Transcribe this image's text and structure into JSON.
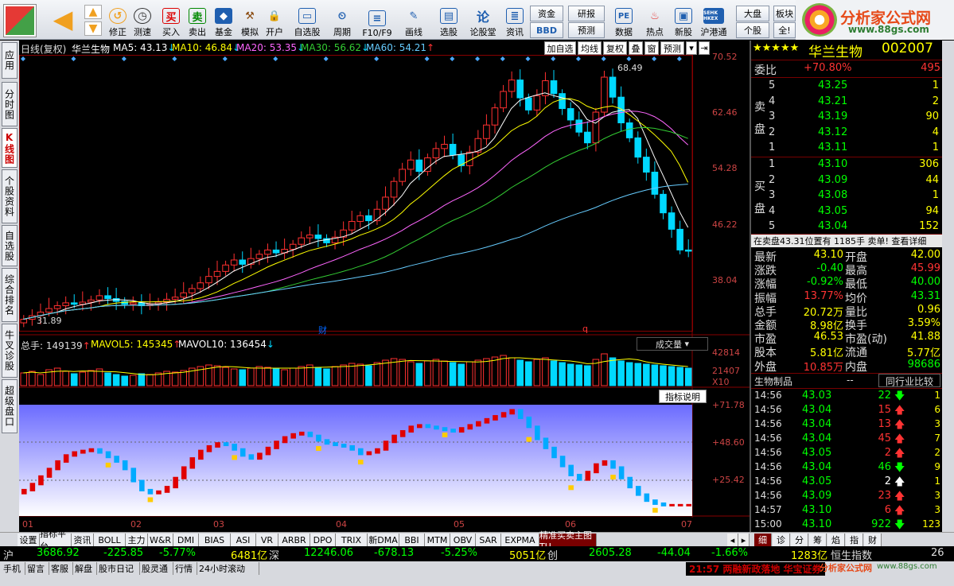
{
  "toolbar": {
    "buttons": [
      {
        "label": "买入",
        "icon": "buy-icon"
      },
      {
        "label": "卖出",
        "icon": "sell-icon"
      },
      {
        "label": "基金",
        "icon": "fund-icon"
      },
      {
        "label": "模拟",
        "icon": "hammer-icon"
      },
      {
        "label": "开户",
        "icon": "lock-icon"
      },
      {
        "label": "自选股",
        "icon": "monitor-icon"
      },
      {
        "label": "周期",
        "icon": "clock-icon"
      },
      {
        "label": "F10/F9",
        "icon": "form-icon"
      },
      {
        "label": "画线",
        "icon": "pen-icon"
      },
      {
        "label": "选股",
        "icon": "chart-icon"
      },
      {
        "label": "论股堂",
        "icon": "talk-icon"
      },
      {
        "label": "资讯",
        "icon": "info-icon"
      },
      {
        "label": "数据",
        "icon": "pe-icon"
      },
      {
        "label": "热点",
        "icon": "fire-icon"
      },
      {
        "label": "新股",
        "icon": "newstock-icon"
      },
      {
        "label": "沪港通",
        "icon": "hkex-icon"
      }
    ],
    "nav_labels": [
      "修正",
      "测速"
    ],
    "box_buttons": [
      "资金",
      "BBD",
      "研报",
      "预测",
      "大盘",
      "个股",
      "板块",
      "全!"
    ],
    "buy_char": "买",
    "sell_char": "卖",
    "glyph_lun": "论",
    "pe_text": "PE",
    "hkex_text": "SEHK HKEX"
  },
  "logo": {
    "brand": "分析家公式网",
    "url": "www.88gs.com"
  },
  "left_tabs": [
    "应用",
    "分时图",
    "K线图",
    "个股资料",
    "自选股",
    "综合排名",
    "牛叉诊股",
    "超级盘口"
  ],
  "chart_header": {
    "period": "日线(复权)",
    "stock": "华兰生物",
    "ma5": "MA5: 43.13",
    "ma10": "MA10: 46.84",
    "ma20": "MA20: 53.35",
    "ma30": "MA30: 56.62",
    "ma60": "MA60: 54.21",
    "buttons": [
      "加自选",
      "均线",
      "复权",
      "叠",
      "窗",
      "预测"
    ]
  },
  "price_axis": [
    "70.52",
    "62.46",
    "54.28",
    "46.22",
    "38.04"
  ],
  "price_annotations": {
    "high": "68.49",
    "low": "31.89",
    "mark1": "财",
    "mark2": "q"
  },
  "vol_header": {
    "total": "总手: 149139",
    "mavol5": "MAVOL5: 145345",
    "mavol10": "MAVOL10: 136454",
    "dropdown": "成交量"
  },
  "vol_axis": [
    "42814",
    "21407",
    "X10"
  ],
  "indicator": {
    "button": "指标说明",
    "axis": [
      "+71.78",
      "+48.60",
      "+25.42"
    ]
  },
  "date_axis": [
    "01",
    "02",
    "03",
    "04",
    "05",
    "06",
    "07"
  ],
  "right_panel": {
    "stars": "★★★★★",
    "name": "华兰生物",
    "code": "002007",
    "wb_label": "委比",
    "wb_value": "+70.80%",
    "wb_diff": "495",
    "sell_label": "卖盘",
    "buy_label": "买盘",
    "asks": [
      {
        "lvl": "5",
        "price": "43.25",
        "vol": "1"
      },
      {
        "lvl": "4",
        "price": "43.21",
        "vol": "2"
      },
      {
        "lvl": "3",
        "price": "43.19",
        "vol": "90"
      },
      {
        "lvl": "2",
        "price": "43.12",
        "vol": "4"
      },
      {
        "lvl": "1",
        "price": "43.11",
        "vol": "1"
      }
    ],
    "bids": [
      {
        "lvl": "1",
        "price": "43.10",
        "vol": "306"
      },
      {
        "lvl": "2",
        "price": "43.09",
        "vol": "44"
      },
      {
        "lvl": "3",
        "price": "43.08",
        "vol": "1"
      },
      {
        "lvl": "4",
        "price": "43.05",
        "vol": "94"
      },
      {
        "lvl": "5",
        "price": "43.04",
        "vol": "152"
      }
    ],
    "notice": "在卖盘43.31位置有 1185手 卖单! 查看详细",
    "stats": [
      {
        "k1": "最新",
        "v1": "43.10",
        "k2": "开盘",
        "v2": "42.00"
      },
      {
        "k1": "涨跌",
        "v1": "-0.40",
        "k2": "最高",
        "v2": "45.99"
      },
      {
        "k1": "涨幅",
        "v1": "-0.92%",
        "k2": "最低",
        "v2": "40.00"
      },
      {
        "k1": "振幅",
        "v1": "13.77%",
        "k2": "均价",
        "v2": "43.31"
      },
      {
        "k1": "总手",
        "v1": "20.72万",
        "k2": "量比",
        "v2": "0.96"
      },
      {
        "k1": "金额",
        "v1": "8.98亿",
        "k2": "换手",
        "v2": "3.59%"
      },
      {
        "k1": "市盈",
        "v1": "46.53",
        "k2": "市盈(动)",
        "v2": "41.88"
      },
      {
        "k1": "股本",
        "v1": "5.81亿",
        "k2": "流通",
        "v2": "5.77亿"
      },
      {
        "k1": "外盘",
        "v1": "10.85万",
        "k2": "内盘",
        "v2": "98686"
      }
    ],
    "industry": "生物制品",
    "industry_dash": "--",
    "compare": "同行业比较",
    "ticks": [
      {
        "time": "14:56",
        "price": "43.03",
        "vol": "22",
        "dir": "down",
        "n": "1"
      },
      {
        "time": "14:56",
        "price": "43.04",
        "vol": "15",
        "dir": "up",
        "n": "6"
      },
      {
        "time": "14:56",
        "price": "43.04",
        "vol": "13",
        "dir": "up",
        "n": "3"
      },
      {
        "time": "14:56",
        "price": "43.04",
        "vol": "45",
        "dir": "up",
        "n": "7"
      },
      {
        "time": "14:56",
        "price": "43.05",
        "vol": "2",
        "dir": "up",
        "n": "2"
      },
      {
        "time": "14:56",
        "price": "43.04",
        "vol": "46",
        "dir": "down",
        "n": "9"
      },
      {
        "time": "14:56",
        "price": "43.05",
        "vol": "2",
        "dir": "flat",
        "n": "1"
      },
      {
        "time": "14:56",
        "price": "43.09",
        "vol": "23",
        "dir": "up",
        "n": "3"
      },
      {
        "time": "14:57",
        "price": "43.10",
        "vol": "6",
        "dir": "up",
        "n": "3"
      },
      {
        "time": "15:00",
        "price": "43.10",
        "vol": "922",
        "dir": "down",
        "n": "123"
      }
    ],
    "tabs": [
      "细",
      "诊",
      "分",
      "筹",
      "焰",
      "指",
      "财"
    ]
  },
  "bottom_tabs": [
    "设置",
    "指标平台",
    "资讯",
    "BOLL",
    "主力",
    "W&R",
    "DMI",
    "BIAS",
    "ASI",
    "VR",
    "ARBR",
    "DPO",
    "TRIX",
    "新DMA",
    "BBI",
    "MTM",
    "OBV",
    "SAR",
    "EXPMA",
    "精准买卖主图TU"
  ],
  "index_bar": {
    "sh_label": "沪",
    "sh_val": "3686.92",
    "sh_chg": "-225.85",
    "sh_pct": "-5.77%",
    "sh_amt": "6481亿",
    "sz_label": "深",
    "sz_val": "12246.06",
    "sz_chg": "-678.13",
    "sz_pct": "-5.25%",
    "sz_amt": "5051亿",
    "cy_label": "创",
    "cy_val": "2605.28",
    "cy_chg": "-44.04",
    "cy_pct": "-1.66%",
    "cy_amt": "1283亿",
    "hs_label": "恒生指数",
    "hs_val": "26"
  },
  "status": {
    "buttons": [
      "手机",
      "留言",
      "客服",
      "解盘",
      "股市日记",
      "股灵通",
      "行情",
      "24小时滚动"
    ],
    "news": "21:57 两融新政落地 华宝证券",
    "brand": "分析家公式网",
    "url": "www.88gs.com"
  },
  "colors": {
    "up": "#ff3030",
    "down": "#00d8ff",
    "ma5": "#ffffff",
    "ma10": "#ffff00",
    "ma20": "#ff66ff",
    "ma30": "#33cc33",
    "ma60": "#66ccff"
  },
  "chart_data": [
    {
      "type": "candlestick",
      "title": "",
      "x": [
        "01",
        "02",
        "03",
        "04",
        "05",
        "06",
        "07"
      ],
      "close": [
        33.5,
        34.0,
        34.5,
        35.0,
        35.4,
        35.8,
        35.6,
        35.9,
        36.2,
        36.8,
        36.4,
        36.0,
        35.6,
        35.8,
        35.4,
        35.6,
        35.9,
        36.3,
        36.6,
        37.2,
        37.8,
        38.6,
        39.5,
        40.2,
        41.1,
        41.8,
        41.2,
        42.0,
        42.6,
        43.2,
        42.8,
        43.3,
        44.0,
        44.9,
        45.3,
        44.8,
        44.2,
        45.0,
        46.0,
        47.2,
        48.0,
        47.3,
        48.9,
        50.6,
        52.8,
        54.5,
        55.8,
        54.2,
        56.1,
        57.4,
        58.0,
        56.5,
        55.0,
        56.9,
        58.8,
        60.7,
        63.1,
        65.4,
        67.0,
        64.5,
        62.8,
        64.8,
        66.9,
        65.1,
        63.0,
        61.4,
        59.7,
        58.2,
        62.5,
        67.4,
        64.6,
        61.0,
        58.9,
        56.2,
        54.1,
        51.0,
        48.4,
        46.1,
        43.2,
        43.1
      ],
      "ylim": [
        31.89,
        70.52
      ],
      "high": 68.49,
      "low": 31.89,
      "ma": [
        {
          "name": "MA5",
          "last": 43.13
        },
        {
          "name": "MA10",
          "last": 46.84
        },
        {
          "name": "MA20",
          "last": 53.35
        },
        {
          "name": "MA30",
          "last": 56.62
        },
        {
          "name": "MA60",
          "last": 54.21
        }
      ]
    },
    {
      "type": "bar",
      "title": "成交量",
      "ylim": [
        0,
        42814
      ],
      "values": [
        16,
        18,
        14,
        20,
        22,
        18,
        15,
        17,
        19,
        21,
        16,
        14,
        12,
        13,
        15,
        14,
        16,
        18,
        17,
        19,
        22,
        24,
        26,
        25,
        23,
        21,
        20,
        22,
        24,
        23,
        21,
        20,
        22,
        24,
        26,
        23,
        21,
        24,
        26,
        28,
        27,
        25,
        29,
        32,
        34,
        33,
        30,
        28,
        31,
        33,
        31,
        29,
        27,
        30,
        32,
        34,
        36,
        38,
        35,
        32,
        30,
        33,
        35,
        31,
        29,
        27,
        26,
        25,
        33,
        40,
        35,
        31,
        29,
        28,
        27,
        26,
        25,
        24,
        23,
        22
      ]
    },
    {
      "type": "bar",
      "title": "精准买卖主图TU",
      "ylim": [
        0,
        71.78
      ],
      "values": [
        18,
        22,
        27,
        32,
        37,
        41,
        43,
        44,
        45,
        43,
        40,
        37,
        32,
        24,
        18,
        16,
        17,
        20,
        26,
        33,
        39,
        44,
        47,
        49,
        48,
        45,
        41,
        39,
        42,
        46,
        50,
        53,
        55,
        56,
        54,
        51,
        49,
        48,
        47,
        45,
        42,
        43,
        45,
        50,
        54,
        57,
        60,
        61,
        60,
        59,
        58,
        57,
        59,
        61,
        63,
        65,
        67,
        69,
        71,
        66,
        60,
        52,
        46,
        40,
        34,
        28,
        25,
        30,
        35,
        37,
        33,
        26,
        20,
        15,
        11,
        9,
        8,
        8,
        8,
        8
      ]
    }
  ]
}
